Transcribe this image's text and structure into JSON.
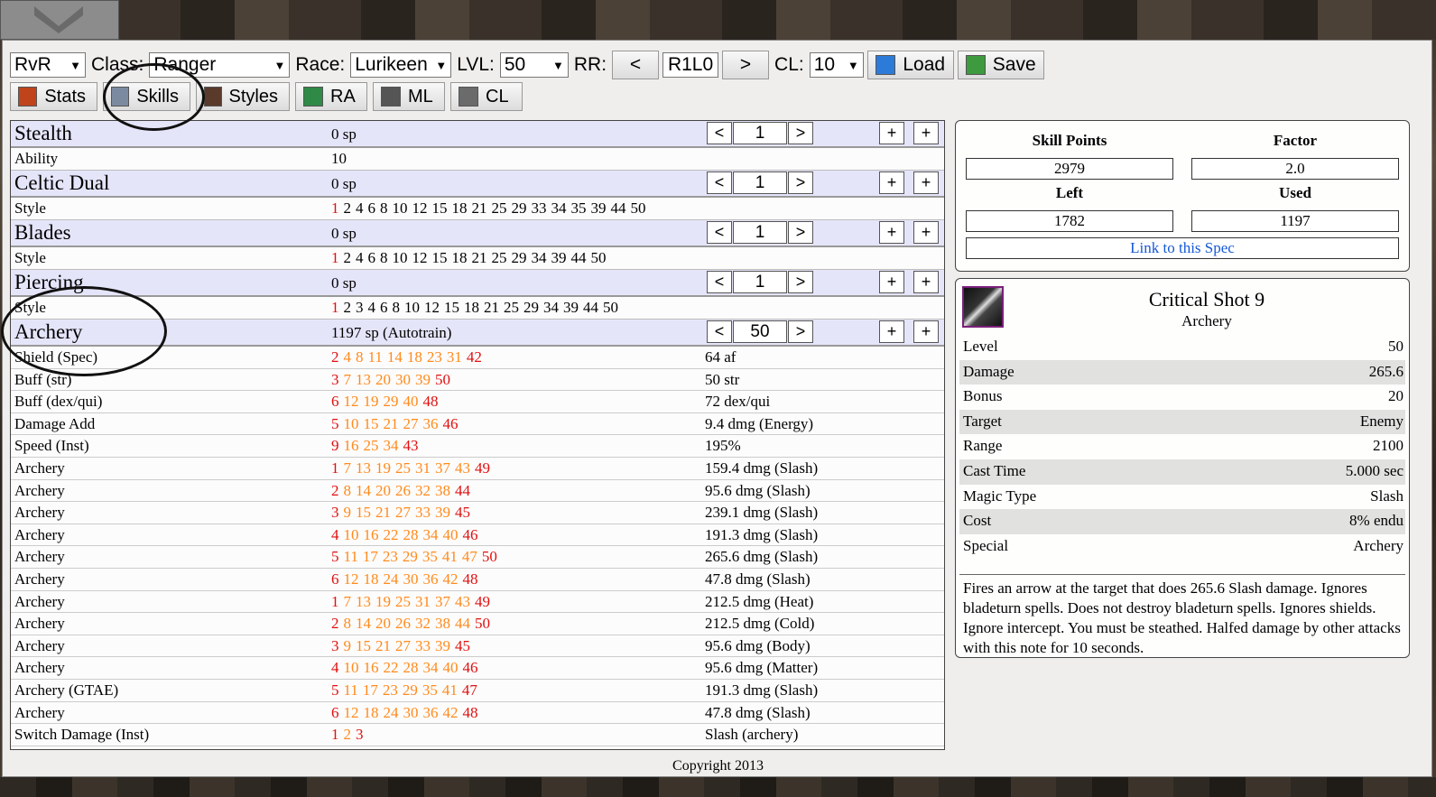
{
  "toolbar": {
    "mode": "RvR",
    "class_label": "Class:",
    "class_value": "Ranger",
    "race_label": "Race:",
    "race_value": "Lurikeen",
    "lvl_label": "LVL:",
    "lvl_value": "50",
    "rr_label": "RR:",
    "rr_prev": "<",
    "rr_value": "R1L0",
    "rr_next": ">",
    "cl_label": "CL:",
    "cl_value": "10",
    "load_label": "Load",
    "save_label": "Save"
  },
  "tabs": [
    {
      "label": "Stats"
    },
    {
      "label": "Skills"
    },
    {
      "label": "Styles"
    },
    {
      "label": "RA"
    },
    {
      "label": "ML"
    },
    {
      "label": "CL"
    }
  ],
  "controls": {
    "minus": "<",
    "plus_arrow": ">",
    "add": "+"
  },
  "skills": {
    "stealth": {
      "name": "Stealth",
      "sp": "0 sp",
      "level": "1"
    },
    "ability": {
      "name": "Ability",
      "value": "10"
    },
    "celtic_dual": {
      "name": "Celtic Dual",
      "sp": "0 sp",
      "level": "1"
    },
    "celtic_style": {
      "name": "Style",
      "levels": [
        "1",
        "2",
        "4",
        "6",
        "8",
        "10",
        "12",
        "15",
        "18",
        "21",
        "25",
        "29",
        "33",
        "34",
        "35",
        "39",
        "44",
        "50"
      ]
    },
    "blades": {
      "name": "Blades",
      "sp": "0 sp",
      "level": "1"
    },
    "blades_style": {
      "name": "Style",
      "levels": [
        "1",
        "2",
        "4",
        "6",
        "8",
        "10",
        "12",
        "15",
        "18",
        "21",
        "25",
        "29",
        "34",
        "39",
        "44",
        "50"
      ]
    },
    "piercing": {
      "name": "Piercing",
      "sp": "0 sp",
      "level": "1"
    },
    "piercing_style": {
      "name": "Style",
      "levels": [
        "1",
        "2",
        "3",
        "4",
        "6",
        "8",
        "10",
        "12",
        "15",
        "18",
        "21",
        "25",
        "29",
        "34",
        "39",
        "44",
        "50"
      ]
    },
    "archery": {
      "name": "Archery",
      "sp": "1197 sp (Autotrain)",
      "level": "50"
    },
    "abilities": [
      {
        "name": "Shield (Spec)",
        "levels": [
          "2",
          "4",
          "8",
          "11",
          "14",
          "18",
          "23",
          "31",
          "42"
        ],
        "value": "64 af"
      },
      {
        "name": "Buff (str)",
        "levels": [
          "3",
          "7",
          "13",
          "20",
          "30",
          "39",
          "50"
        ],
        "value": "50 str"
      },
      {
        "name": "Buff (dex/qui)",
        "levels": [
          "6",
          "12",
          "19",
          "29",
          "40",
          "48"
        ],
        "value": "72 dex/qui"
      },
      {
        "name": "Damage Add",
        "levels": [
          "5",
          "10",
          "15",
          "21",
          "27",
          "36",
          "46"
        ],
        "value": "9.4 dmg (Energy)"
      },
      {
        "name": "Speed (Inst)",
        "levels": [
          "9",
          "16",
          "25",
          "34",
          "43"
        ],
        "value": "195%"
      },
      {
        "name": "Archery",
        "levels": [
          "1",
          "7",
          "13",
          "19",
          "25",
          "31",
          "37",
          "43",
          "49"
        ],
        "value": "159.4 dmg (Slash)"
      },
      {
        "name": "Archery",
        "levels": [
          "2",
          "8",
          "14",
          "20",
          "26",
          "32",
          "38",
          "44"
        ],
        "value": "95.6 dmg (Slash)"
      },
      {
        "name": "Archery",
        "levels": [
          "3",
          "9",
          "15",
          "21",
          "27",
          "33",
          "39",
          "45"
        ],
        "value": "239.1 dmg (Slash)"
      },
      {
        "name": "Archery",
        "levels": [
          "4",
          "10",
          "16",
          "22",
          "28",
          "34",
          "40",
          "46"
        ],
        "value": "191.3 dmg (Slash)"
      },
      {
        "name": "Archery",
        "levels": [
          "5",
          "11",
          "17",
          "23",
          "29",
          "35",
          "41",
          "47",
          "50"
        ],
        "value": "265.6 dmg (Slash)"
      },
      {
        "name": "Archery",
        "levels": [
          "6",
          "12",
          "18",
          "24",
          "30",
          "36",
          "42",
          "48"
        ],
        "value": "47.8 dmg (Slash)"
      },
      {
        "name": "Archery",
        "levels": [
          "1",
          "7",
          "13",
          "19",
          "25",
          "31",
          "37",
          "43",
          "49"
        ],
        "value": "212.5 dmg (Heat)"
      },
      {
        "name": "Archery",
        "levels": [
          "2",
          "8",
          "14",
          "20",
          "26",
          "32",
          "38",
          "44",
          "50"
        ],
        "value": "212.5 dmg (Cold)"
      },
      {
        "name": "Archery",
        "levels": [
          "3",
          "9",
          "15",
          "21",
          "27",
          "33",
          "39",
          "45"
        ],
        "value": "95.6 dmg (Body)"
      },
      {
        "name": "Archery",
        "levels": [
          "4",
          "10",
          "16",
          "22",
          "28",
          "34",
          "40",
          "46"
        ],
        "value": "95.6 dmg (Matter)"
      },
      {
        "name": "Archery (GTAE)",
        "levels": [
          "5",
          "11",
          "17",
          "23",
          "29",
          "35",
          "41",
          "47"
        ],
        "value": "191.3 dmg (Slash)"
      },
      {
        "name": "Archery",
        "levels": [
          "6",
          "12",
          "18",
          "24",
          "30",
          "36",
          "42",
          "48"
        ],
        "value": "47.8 dmg (Slash)"
      },
      {
        "name": "Switch Damage (Inst)",
        "levels": [
          "1",
          "2",
          "3"
        ],
        "value": "Slash (archery)"
      }
    ]
  },
  "skill_points": {
    "skill_points_label": "Skill Points",
    "skill_points_value": "2979",
    "factor_label": "Factor",
    "factor_value": "2.0",
    "left_label": "Left",
    "left_value": "1782",
    "used_label": "Used",
    "used_value": "1197",
    "link_label": "Link to this Spec"
  },
  "detail": {
    "title": "Critical Shot 9",
    "subtitle": "Archery",
    "rows": [
      {
        "k": "Level",
        "v": "50"
      },
      {
        "k": "Damage",
        "v": "265.6"
      },
      {
        "k": "Bonus",
        "v": "20"
      },
      {
        "k": "Target",
        "v": "Enemy"
      },
      {
        "k": "Range",
        "v": "2100"
      },
      {
        "k": "Cast Time",
        "v": "5.000 sec"
      },
      {
        "k": "Magic Type",
        "v": "Slash"
      },
      {
        "k": "Cost",
        "v": "8% endu"
      },
      {
        "k": "Special",
        "v": "Archery"
      }
    ],
    "description": "Fires an arrow at the target that does 265.6 Slash damage. Ignores bladeturn spells. Does not destroy bladeturn spells. Ignores shields. Ignore intercept. You must be steathed. Halfed damage by other attacks with this note for 10 seconds."
  },
  "footer": {
    "copyright": "Copyright 2013"
  },
  "colors": {
    "accent_red": "#e01010",
    "accent_orange": "#ff8a1c",
    "skill_header_bg": "#e5e5fa",
    "link": "#1558d6"
  }
}
